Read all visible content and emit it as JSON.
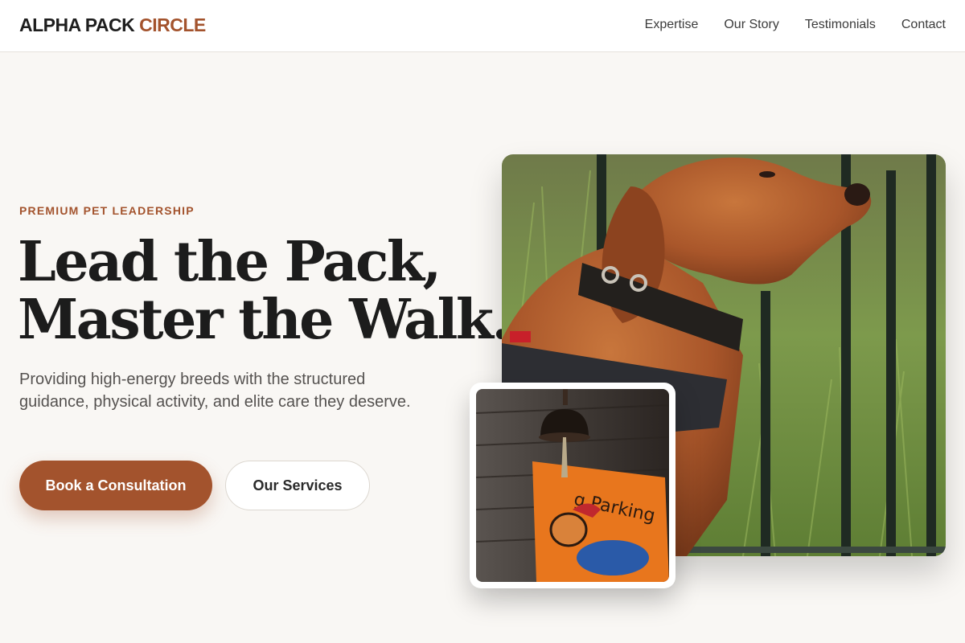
{
  "header": {
    "logo_primary": "ALPHA PACK",
    "logo_accent": "CIRCLE",
    "nav": [
      {
        "label": "Expertise"
      },
      {
        "label": "Our Story"
      },
      {
        "label": "Testimonials"
      },
      {
        "label": "Contact"
      }
    ]
  },
  "hero": {
    "eyebrow": "PREMIUM PET LEADERSHIP",
    "headline_line1": "Lead the Pack,",
    "headline_line2": "Master the Walk.",
    "subtitle": "Providing high-energy breeds with the structured guidance, physical activity, and elite care they deserve.",
    "primary_button": "Book a Consultation",
    "secondary_button": "Our Services",
    "main_image_icon": "dog-photo",
    "inset_image_icon": "dog-parking-sign-photo",
    "inset_sign_text": "g Parking"
  },
  "colors": {
    "accent": "#a3532d",
    "background": "#f9f7f4",
    "text": "#1c1c1c"
  }
}
